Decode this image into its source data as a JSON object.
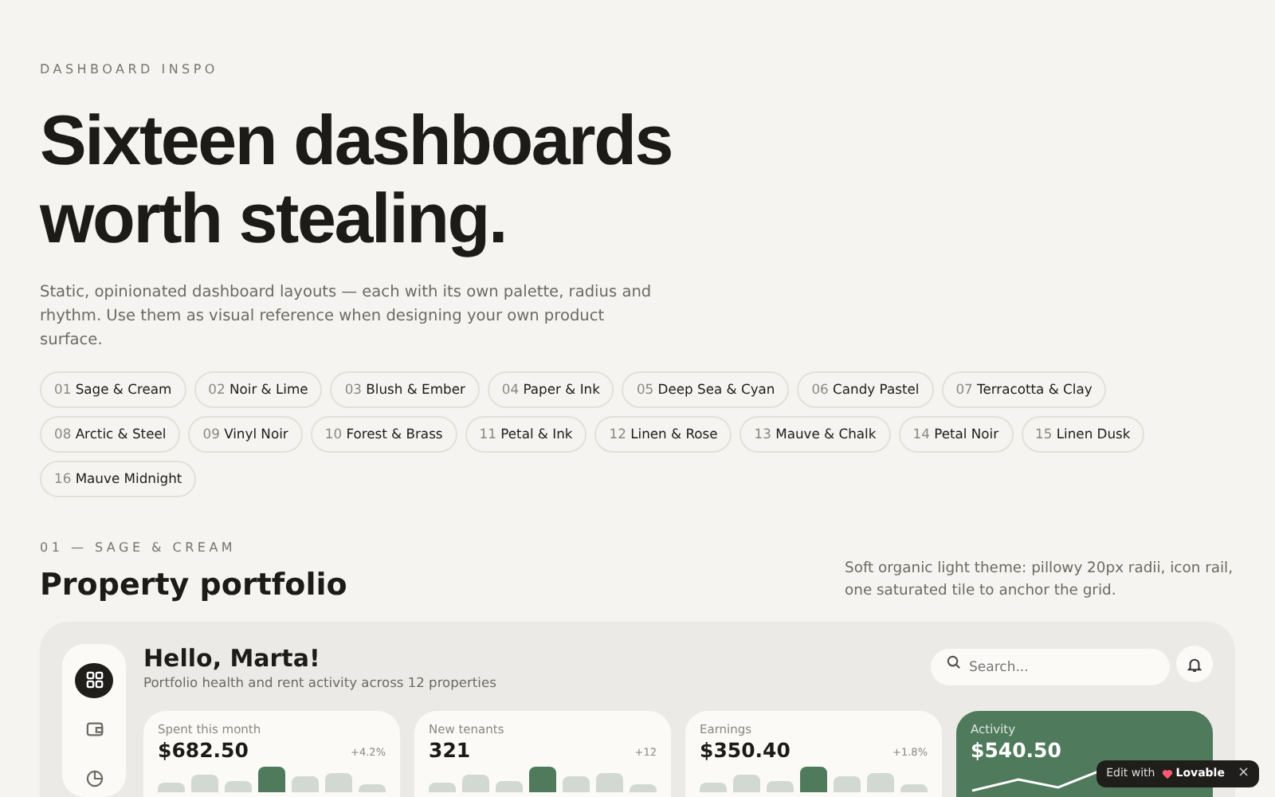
{
  "eyebrow": "DASHBOARD INSPO",
  "headline": "Sixteen dashboards worth stealing.",
  "intro": "Static, opinionated dashboard layouts — each with its own palette, radius and rhythm. Use them as visual reference when designing your own product surface.",
  "themes": [
    {
      "number": "01",
      "name": "Sage & Cream"
    },
    {
      "number": "02",
      "name": "Noir & Lime"
    },
    {
      "number": "03",
      "name": "Blush & Ember"
    },
    {
      "number": "04",
      "name": "Paper & Ink"
    },
    {
      "number": "05",
      "name": "Deep Sea & Cyan"
    },
    {
      "number": "06",
      "name": "Candy Pastel"
    },
    {
      "number": "07",
      "name": "Terracotta & Clay"
    },
    {
      "number": "08",
      "name": "Arctic & Steel"
    },
    {
      "number": "09",
      "name": "Vinyl Noir"
    },
    {
      "number": "10",
      "name": "Forest & Brass"
    },
    {
      "number": "11",
      "name": "Petal & Ink"
    },
    {
      "number": "12",
      "name": "Linen & Rose"
    },
    {
      "number": "13",
      "name": "Mauve & Chalk"
    },
    {
      "number": "14",
      "name": "Petal Noir"
    },
    {
      "number": "15",
      "name": "Linen Dusk"
    },
    {
      "number": "16",
      "name": "Mauve Midnight"
    }
  ],
  "section": {
    "eyebrow": "01 — SAGE & CREAM",
    "title": "Property portfolio",
    "description": "Soft organic light theme: pillowy 20px radii, icon rail, one saturated tile to anchor the grid."
  },
  "preview": {
    "rail": [
      {
        "selected": true
      },
      {
        "selected": false
      },
      {
        "selected": false
      }
    ],
    "greeting": "Hello, Marta!",
    "subtitle": "Portfolio health and rent activity across 12 properties",
    "search": {
      "placeholder": "Search..."
    },
    "tiles": [
      {
        "kind": "bars",
        "label": "Spent this month",
        "value": "$682.50",
        "delta": "+4.2%"
      },
      {
        "kind": "bars",
        "label": "New tenants",
        "value": "321",
        "delta": "+12"
      },
      {
        "kind": "bars",
        "label": "Earnings",
        "value": "$350.40",
        "delta": "+1.8%"
      },
      {
        "kind": "line",
        "label": "Activity",
        "value": "$540.50"
      }
    ]
  },
  "badge": {
    "prefix": "Edit with",
    "brand": "Lovable",
    "close": "×"
  }
}
